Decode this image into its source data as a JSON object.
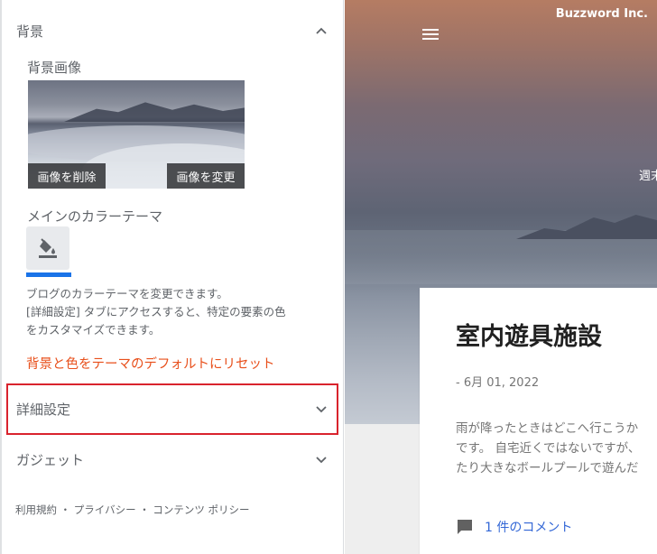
{
  "panel": {
    "background_section": {
      "title": "背景"
    },
    "bg_image_label": "背景画像",
    "thumb_buttons": {
      "delete": "画像を削除",
      "change": "画像を変更"
    },
    "main_theme_label": "メインのカラーテーマ",
    "description_lines": [
      "ブログのカラーテーマを変更できます。",
      "[詳細設定] タブにアクセスすると、特定の要素の色",
      "をカスタマイズできます。"
    ],
    "reset_link": "背景と色をテーマのデフォルトにリセット",
    "advanced_section": {
      "title": "詳細設定"
    },
    "gadget_section": {
      "title": "ガジェット"
    },
    "footer_links": "利用規約 ・ プライバシー ・ コンテンツ ポリシー",
    "accent_color": "#1a73e8",
    "reset_color": "#e8501c",
    "highlight_color": "#d9232d"
  },
  "preview": {
    "brand": "Buzzword Inc.",
    "hero_side_text": "週末",
    "post": {
      "title": "室内遊具施設",
      "date": "- 6月 01, 2022",
      "body_lines": [
        "雨が降ったときはどこへ行こうか",
        "です。 自宅近くではないですが、",
        "たり大きなボールプールで遊んだ"
      ],
      "comments": "1 件のコメント"
    },
    "link_color": "#3367d6"
  }
}
